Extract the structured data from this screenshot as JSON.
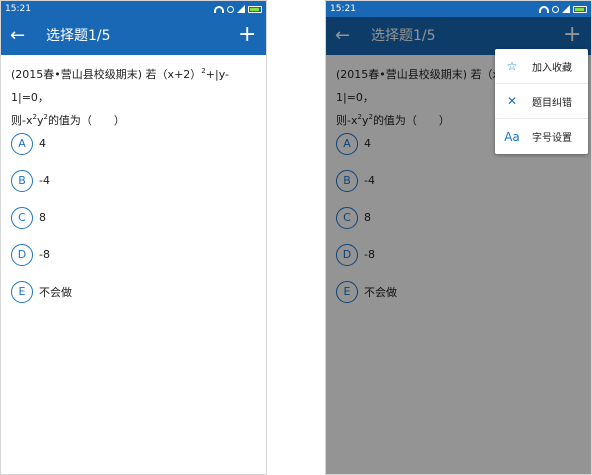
{
  "status_bar": {
    "time": "15:21"
  },
  "app_bar": {
    "back_icon": "←",
    "title": "选择题1/5",
    "plus_icon": "+"
  },
  "question": {
    "line1_prefix": "(2015春•营山县校级期末) 若（x+2）",
    "line1_sup": "2",
    "line1_suffix": "+|y-1|=0，",
    "line2_a": "则-x",
    "line2_sup1": "2",
    "line2_b": "y",
    "line2_sup2": "2",
    "line2_c": "的值为（　　）"
  },
  "options": [
    {
      "letter": "A",
      "text": "4"
    },
    {
      "letter": "B",
      "text": "-4"
    },
    {
      "letter": "C",
      "text": "8"
    },
    {
      "letter": "D",
      "text": "-8"
    },
    {
      "letter": "E",
      "text": "不会做"
    }
  ],
  "menu": {
    "items": [
      {
        "icon": "☆",
        "icon_name": "star-icon",
        "label": "加入收藏"
      },
      {
        "icon": "✕",
        "icon_name": "close-icon",
        "label": "题目纠错"
      },
      {
        "icon": "Aa",
        "icon_name": "font-size-icon",
        "label": "字号设置"
      }
    ]
  },
  "colors": {
    "primary": "#1868b6",
    "accent": "#1a73c8"
  }
}
